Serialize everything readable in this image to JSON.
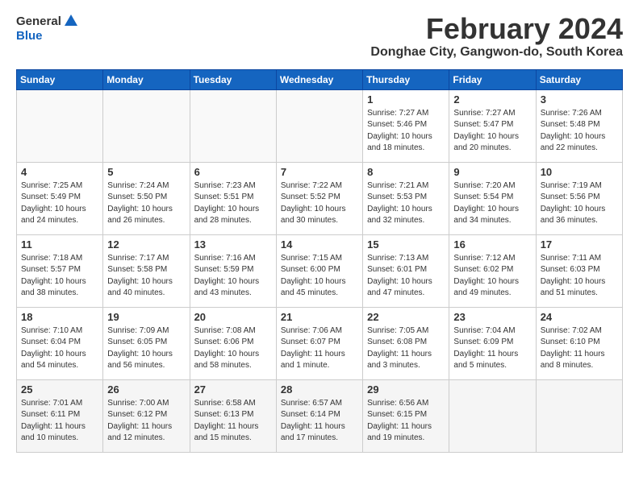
{
  "header": {
    "logo_general": "General",
    "logo_blue": "Blue",
    "month_title": "February 2024",
    "city_subtitle": "Donghae City, Gangwon-do, South Korea"
  },
  "days_of_week": [
    "Sunday",
    "Monday",
    "Tuesday",
    "Wednesday",
    "Thursday",
    "Friday",
    "Saturday"
  ],
  "weeks": [
    [
      {
        "day": "",
        "info": ""
      },
      {
        "day": "",
        "info": ""
      },
      {
        "day": "",
        "info": ""
      },
      {
        "day": "",
        "info": ""
      },
      {
        "day": "1",
        "info": "Sunrise: 7:27 AM\nSunset: 5:46 PM\nDaylight: 10 hours\nand 18 minutes."
      },
      {
        "day": "2",
        "info": "Sunrise: 7:27 AM\nSunset: 5:47 PM\nDaylight: 10 hours\nand 20 minutes."
      },
      {
        "day": "3",
        "info": "Sunrise: 7:26 AM\nSunset: 5:48 PM\nDaylight: 10 hours\nand 22 minutes."
      }
    ],
    [
      {
        "day": "4",
        "info": "Sunrise: 7:25 AM\nSunset: 5:49 PM\nDaylight: 10 hours\nand 24 minutes."
      },
      {
        "day": "5",
        "info": "Sunrise: 7:24 AM\nSunset: 5:50 PM\nDaylight: 10 hours\nand 26 minutes."
      },
      {
        "day": "6",
        "info": "Sunrise: 7:23 AM\nSunset: 5:51 PM\nDaylight: 10 hours\nand 28 minutes."
      },
      {
        "day": "7",
        "info": "Sunrise: 7:22 AM\nSunset: 5:52 PM\nDaylight: 10 hours\nand 30 minutes."
      },
      {
        "day": "8",
        "info": "Sunrise: 7:21 AM\nSunset: 5:53 PM\nDaylight: 10 hours\nand 32 minutes."
      },
      {
        "day": "9",
        "info": "Sunrise: 7:20 AM\nSunset: 5:54 PM\nDaylight: 10 hours\nand 34 minutes."
      },
      {
        "day": "10",
        "info": "Sunrise: 7:19 AM\nSunset: 5:56 PM\nDaylight: 10 hours\nand 36 minutes."
      }
    ],
    [
      {
        "day": "11",
        "info": "Sunrise: 7:18 AM\nSunset: 5:57 PM\nDaylight: 10 hours\nand 38 minutes."
      },
      {
        "day": "12",
        "info": "Sunrise: 7:17 AM\nSunset: 5:58 PM\nDaylight: 10 hours\nand 40 minutes."
      },
      {
        "day": "13",
        "info": "Sunrise: 7:16 AM\nSunset: 5:59 PM\nDaylight: 10 hours\nand 43 minutes."
      },
      {
        "day": "14",
        "info": "Sunrise: 7:15 AM\nSunset: 6:00 PM\nDaylight: 10 hours\nand 45 minutes."
      },
      {
        "day": "15",
        "info": "Sunrise: 7:13 AM\nSunset: 6:01 PM\nDaylight: 10 hours\nand 47 minutes."
      },
      {
        "day": "16",
        "info": "Sunrise: 7:12 AM\nSunset: 6:02 PM\nDaylight: 10 hours\nand 49 minutes."
      },
      {
        "day": "17",
        "info": "Sunrise: 7:11 AM\nSunset: 6:03 PM\nDaylight: 10 hours\nand 51 minutes."
      }
    ],
    [
      {
        "day": "18",
        "info": "Sunrise: 7:10 AM\nSunset: 6:04 PM\nDaylight: 10 hours\nand 54 minutes."
      },
      {
        "day": "19",
        "info": "Sunrise: 7:09 AM\nSunset: 6:05 PM\nDaylight: 10 hours\nand 56 minutes."
      },
      {
        "day": "20",
        "info": "Sunrise: 7:08 AM\nSunset: 6:06 PM\nDaylight: 10 hours\nand 58 minutes."
      },
      {
        "day": "21",
        "info": "Sunrise: 7:06 AM\nSunset: 6:07 PM\nDaylight: 11 hours\nand 1 minute."
      },
      {
        "day": "22",
        "info": "Sunrise: 7:05 AM\nSunset: 6:08 PM\nDaylight: 11 hours\nand 3 minutes."
      },
      {
        "day": "23",
        "info": "Sunrise: 7:04 AM\nSunset: 6:09 PM\nDaylight: 11 hours\nand 5 minutes."
      },
      {
        "day": "24",
        "info": "Sunrise: 7:02 AM\nSunset: 6:10 PM\nDaylight: 11 hours\nand 8 minutes."
      }
    ],
    [
      {
        "day": "25",
        "info": "Sunrise: 7:01 AM\nSunset: 6:11 PM\nDaylight: 11 hours\nand 10 minutes."
      },
      {
        "day": "26",
        "info": "Sunrise: 7:00 AM\nSunset: 6:12 PM\nDaylight: 11 hours\nand 12 minutes."
      },
      {
        "day": "27",
        "info": "Sunrise: 6:58 AM\nSunset: 6:13 PM\nDaylight: 11 hours\nand 15 minutes."
      },
      {
        "day": "28",
        "info": "Sunrise: 6:57 AM\nSunset: 6:14 PM\nDaylight: 11 hours\nand 17 minutes."
      },
      {
        "day": "29",
        "info": "Sunrise: 6:56 AM\nSunset: 6:15 PM\nDaylight: 11 hours\nand 19 minutes."
      },
      {
        "day": "",
        "info": ""
      },
      {
        "day": "",
        "info": ""
      }
    ]
  ]
}
